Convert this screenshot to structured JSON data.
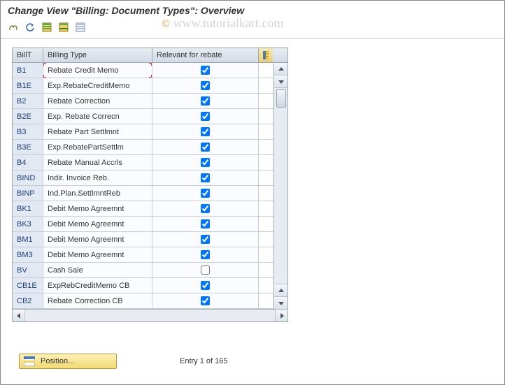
{
  "title": "Change View \"Billing: Document Types\": Overview",
  "watermark": "www.tutorialkart.com",
  "columns": {
    "billt": "BillT",
    "billing_type": "Billing Type",
    "relevant_for_rebate": "Relevant for rebate"
  },
  "rows": [
    {
      "billt": "B1",
      "btype": "Rebate Credit Memo",
      "reb": true
    },
    {
      "billt": "B1E",
      "btype": "Exp.RebateCreditMemo",
      "reb": true
    },
    {
      "billt": "B2",
      "btype": "Rebate Correction",
      "reb": true
    },
    {
      "billt": "B2E",
      "btype": "Exp. Rebate Correcn",
      "reb": true
    },
    {
      "billt": "B3",
      "btype": "Rebate Part Settlmnt",
      "reb": true
    },
    {
      "billt": "B3E",
      "btype": "Exp.RebatePartSettlm",
      "reb": true
    },
    {
      "billt": "B4",
      "btype": "Rebate Manual Accrls",
      "reb": true
    },
    {
      "billt": "BIND",
      "btype": "Indir. Invoice Reb.",
      "reb": true
    },
    {
      "billt": "BINP",
      "btype": "Ind.Plan.SettlmntReb",
      "reb": true
    },
    {
      "billt": "BK1",
      "btype": "Debit Memo Agreemnt",
      "reb": true
    },
    {
      "billt": "BK3",
      "btype": "Debit Memo Agreemnt",
      "reb": true
    },
    {
      "billt": "BM1",
      "btype": "Debit Memo Agreemnt",
      "reb": true
    },
    {
      "billt": "BM3",
      "btype": "Debit Memo Agreemnt",
      "reb": true
    },
    {
      "billt": "BV",
      "btype": "Cash Sale",
      "reb": false
    },
    {
      "billt": "CB1E",
      "btype": "ExpRebCreditMemo CB",
      "reb": true
    },
    {
      "billt": "CB2",
      "btype": "Rebate Correction CB",
      "reb": true
    }
  ],
  "footer": {
    "position_label": "Position...",
    "entry_text": "Entry 1 of 165"
  }
}
